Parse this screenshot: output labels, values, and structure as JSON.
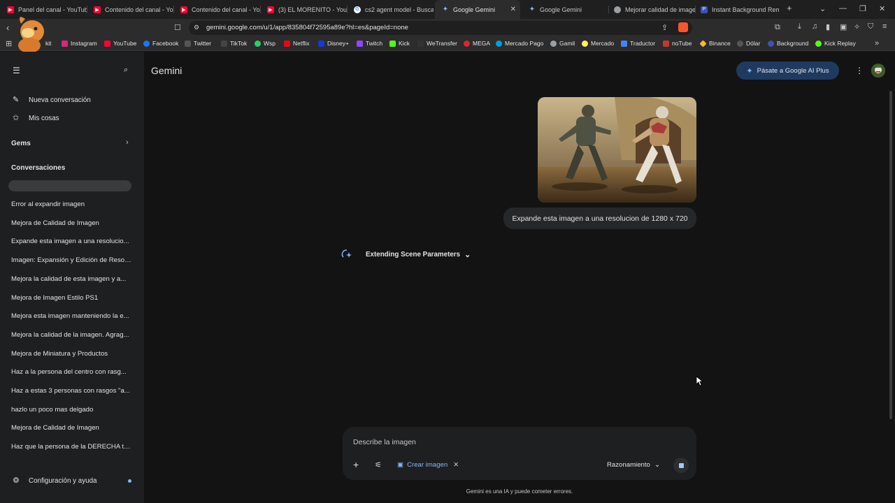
{
  "browser": {
    "tabs": [
      {
        "label": "Panel del canal - YouTube",
        "favicon": "youtube-icon",
        "color": "#ff0033"
      },
      {
        "label": "Contenido del canal - You",
        "favicon": "youtube-icon",
        "color": "#ff0033"
      },
      {
        "label": "Contenido del canal - You",
        "favicon": "youtube-icon",
        "color": "#ff0033"
      },
      {
        "label": "(3) EL MORENITO - YouTu",
        "favicon": "youtube-icon",
        "color": "#ff0033"
      },
      {
        "label": "cs2 agent model - Buscar",
        "favicon": "google-icon",
        "color": "#4285f4"
      },
      {
        "label": "Google Gemini",
        "favicon": "gemini-icon",
        "color": "#8ab4f8"
      },
      {
        "label": "Google Gemini",
        "favicon": "gemini-icon",
        "color": "#8ab4f8"
      },
      {
        "label": "Mejorar calidad de image",
        "favicon": "generic-icon",
        "color": "#9aa0a6"
      },
      {
        "label": "Instant Background Remo",
        "favicon": "generic-icon",
        "color": "#3f51b5"
      }
    ],
    "url": "gemini.google.com/u/1/app/835804f72595a89e?hl=es&pageId=none",
    "bookmarks": [
      {
        "label": "kit",
        "color": "#f28b30"
      },
      {
        "label": "Instagram",
        "color": "#d62976"
      },
      {
        "label": "YouTube",
        "color": "#ff0033"
      },
      {
        "label": "Facebook",
        "color": "#1877f2"
      },
      {
        "label": "Twitter",
        "color": "#e3e3e3"
      },
      {
        "label": "TikTok",
        "color": "#e3e3e3"
      },
      {
        "label": "Wsp",
        "color": "#25d366"
      },
      {
        "label": "Netflix",
        "color": "#e50914"
      },
      {
        "label": "Disney+",
        "color": "#113ccf"
      },
      {
        "label": "Twitch",
        "color": "#9146ff"
      },
      {
        "label": "Kick",
        "color": "#53fc18"
      },
      {
        "label": "WeTransfer",
        "color": "#e3e3e3"
      },
      {
        "label": "MEGA",
        "color": "#d9272e"
      },
      {
        "label": "Mercado Pago",
        "color": "#009ee3"
      },
      {
        "label": "Gamil",
        "color": "#9aa0a6"
      },
      {
        "label": "Mercado",
        "color": "#fff159"
      },
      {
        "label": "Traductor",
        "color": "#4285f4"
      },
      {
        "label": "noTube",
        "color": "#e3e3e3"
      },
      {
        "label": "Binance",
        "color": "#f3ba2f"
      },
      {
        "label": "Dólar",
        "color": "#9aa0a6"
      },
      {
        "label": "Background",
        "color": "#3f51b5"
      },
      {
        "label": "Kick Replay",
        "color": "#53fc18"
      }
    ]
  },
  "sidebar": {
    "new_chat": "Nueva conversación",
    "my_stuff": "Mis cosas",
    "gems": "Gems",
    "conversations_heading": "Conversaciones",
    "conversations": [
      "Error al expandir imagen",
      "Mejora de Calidad de Imagen",
      "Expande esta imagen a una resolucio...",
      "Imagen: Expansión y Edición de Resol...",
      "Mejora la calidad de esta imagen y a...",
      "Mejora de Imagen Estilo PS1",
      "Mejora esta imagen manteniendo la e...",
      "Mejora la calidad de la imagen. Agrag...",
      "Mejora de Miniatura y Productos",
      "Haz a la persona del centro con rasg...",
      "Haz a estas 3 personas con rasgos \"a...",
      "hazlo un poco mas delgado",
      "Mejora de Calidad de Imagen",
      "Haz que la persona de la DERECHA te..."
    ],
    "settings": "Configuración y ayuda"
  },
  "main": {
    "title": "Gemini",
    "upgrade_label": "Pásate a Google AI Plus",
    "user_message": "Expande esta imagen a una resolucion de 1280 x 720",
    "thinking_label": "Extending Scene Parameters",
    "composer": {
      "placeholder": "Describe la imagen",
      "create_image_chip": "Crear imagen",
      "mode_label": "Razonamiento"
    },
    "disclaimer": "Gemini es una IA y puede cometer errores."
  },
  "colors": {
    "accent": "#8ab4f8",
    "upgrade_bg": "#1e3a5f",
    "background": "#131314",
    "sidebar_bg": "#1e1f20"
  }
}
